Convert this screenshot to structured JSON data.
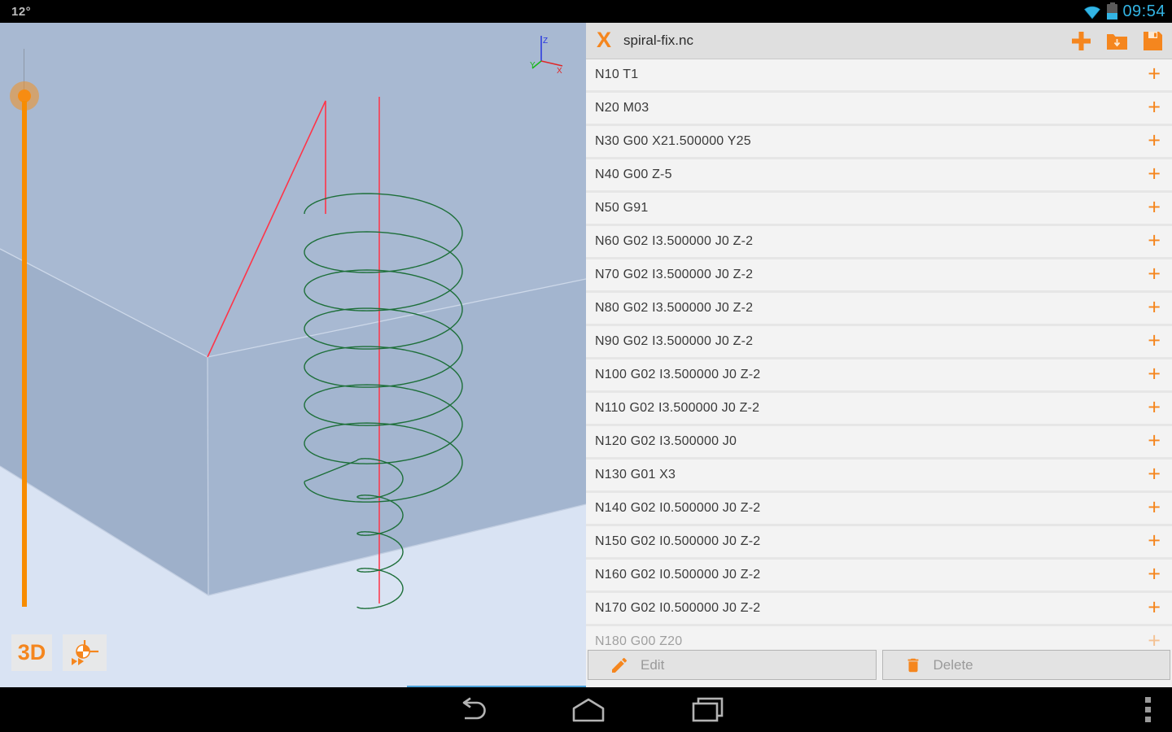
{
  "status_bar": {
    "temperature": "12°",
    "time": "09:54"
  },
  "viewport": {
    "mode_button_label": "3D",
    "axis_labels": {
      "x": "X",
      "y": "Y",
      "z": "Z"
    }
  },
  "editor": {
    "logo": "X",
    "filename": "spiral-fix.nc",
    "row_action": "+",
    "lines": [
      "N10 T1",
      "N20 M03",
      "N30 G00 X21.500000 Y25",
      "N40 G00 Z-5",
      "N50 G91",
      "N60 G02 I3.500000 J0 Z-2",
      "N70 G02 I3.500000 J0 Z-2",
      "N80 G02 I3.500000 J0 Z-2",
      "N90 G02 I3.500000 J0 Z-2",
      "N100 G02 I3.500000 J0 Z-2",
      "N110 G02 I3.500000 J0 Z-2",
      "N120 G02 I3.500000 J0",
      "N130 G01 X3",
      "N140 G02 I0.500000 J0 Z-2",
      "N150 G02 I0.500000 J0 Z-2",
      "N160 G02 I0.500000 J0 Z-2",
      "N170 G02 I0.500000 J0 Z-2",
      "N180 G00 Z20"
    ],
    "edit_button": "Edit",
    "delete_button": "Delete"
  },
  "colors": {
    "accent_orange": "#f5861e",
    "holo_blue": "#33b5e5",
    "toolpath_green": "#1d6f39",
    "rapid_red": "#ff3448",
    "workpiece_top": "#a8b9d2",
    "workpiece_left": "#9eb0ca",
    "workpiece_right": "#a3b5cf",
    "viewport_bg": "#d9e3f3"
  }
}
